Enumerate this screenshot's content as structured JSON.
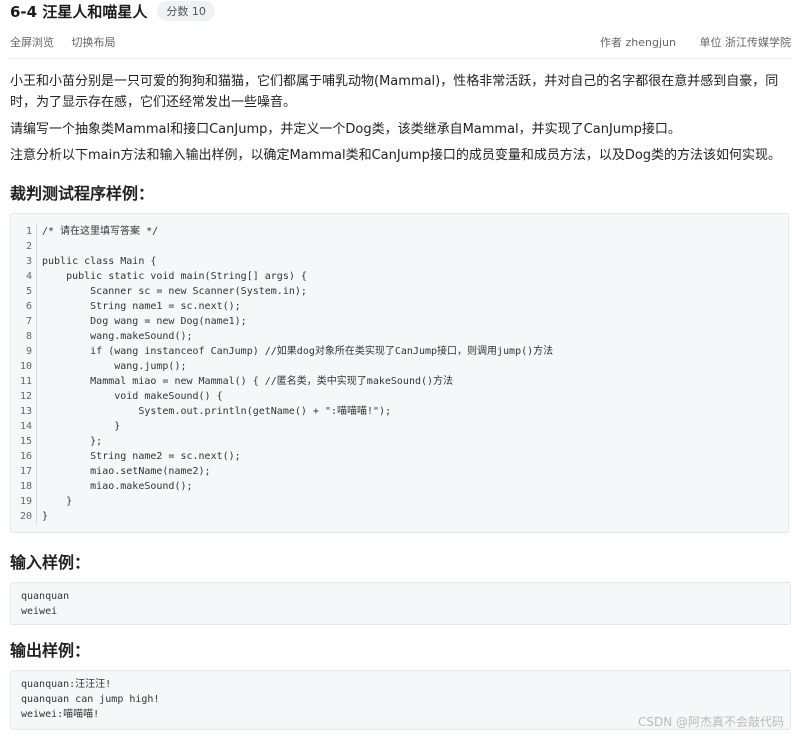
{
  "header": {
    "title": "6-4 汪星人和喵星人",
    "score": "分数 10"
  },
  "toolbar": {
    "fullscreen": "全屏浏览",
    "switch_layout": "切换布局",
    "author": "作者 zhengjun",
    "org": "单位 浙江传媒学院"
  },
  "description": {
    "p1": "小王和小苗分别是一只可爱的狗狗和猫猫，它们都属于哺乳动物(Mammal)，性格非常活跃，并对自己的名字都很在意并感到自豪，同时，为了显示存在感，它们还经常发出一些噪音。",
    "p2": "请编写一个抽象类Mammal和接口CanJump，并定义一个Dog类，该类继承自Mammal，并实现了CanJump接口。",
    "p3": "注意分析以下main方法和输入输出样例，以确定Mammal类和CanJump接口的成员变量和成员方法，以及Dog类的方法该如何实现。"
  },
  "sections": {
    "judge": "裁判测试程序样例：",
    "input": "输入样例：",
    "output": "输出样例："
  },
  "code": [
    {
      "n": "1",
      "t": "/* 请在这里填写答案 */"
    },
    {
      "n": "2",
      "t": ""
    },
    {
      "n": "3",
      "t": "public class Main {"
    },
    {
      "n": "4",
      "t": "    public static void main(String[] args) {"
    },
    {
      "n": "5",
      "t": "        Scanner sc = new Scanner(System.in);"
    },
    {
      "n": "6",
      "t": "        String name1 = sc.next();"
    },
    {
      "n": "7",
      "t": "        Dog wang = new Dog(name1);"
    },
    {
      "n": "8",
      "t": "        wang.makeSound();"
    },
    {
      "n": "9",
      "t": "        if (wang instanceof CanJump) //如果dog对象所在类实现了CanJump接口，则调用jump()方法"
    },
    {
      "n": "10",
      "t": "            wang.jump();"
    },
    {
      "n": "11",
      "t": "        Mammal miao = new Mammal() { //匿名类，类中实现了makeSound()方法"
    },
    {
      "n": "12",
      "t": "            void makeSound() {"
    },
    {
      "n": "13",
      "t": "                System.out.println(getName() + \":喵喵喵!\");"
    },
    {
      "n": "14",
      "t": "            }"
    },
    {
      "n": "15",
      "t": "        };"
    },
    {
      "n": "16",
      "t": "        String name2 = sc.next();"
    },
    {
      "n": "17",
      "t": "        miao.setName(name2);"
    },
    {
      "n": "18",
      "t": "        miao.makeSound();"
    },
    {
      "n": "19",
      "t": "    }"
    },
    {
      "n": "20",
      "t": "}"
    }
  ],
  "input_sample": "quanquan\nweiwei",
  "output_sample": "quanquan:汪汪汪!\nquanquan can jump high!\nweiwei:喵喵喵!",
  "watermark": "CSDN @阿杰真不会敲代码"
}
